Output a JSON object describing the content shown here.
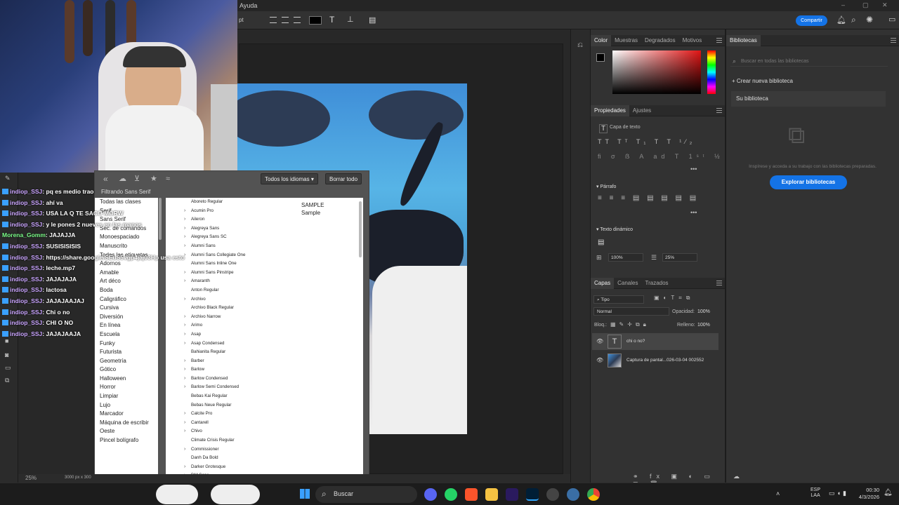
{
  "menu": {
    "help": "Ayuda"
  },
  "options_bar": {
    "font_size_unit": "pt",
    "share_label": "Compartir"
  },
  "color_panel": {
    "tabs": [
      "Color",
      "Muestras",
      "Degradados",
      "Motivos"
    ],
    "foreground": "#000000",
    "hue_selected": "#e01414"
  },
  "properties_panel": {
    "tabs": [
      "Propiedades",
      "Ajustes"
    ],
    "layer_type": "Capa de texto",
    "paragraph_label": "Párrafo",
    "dynamic_text_label": "Texto dinámico",
    "width_value": "100%",
    "tracking_value": "25%"
  },
  "libraries_panel": {
    "tab": "Bibliotecas",
    "search_placeholder": "Buscar en todas las bibliotecas",
    "create_label": "Crear nueva biblioteca",
    "your_library": "Su biblioteca",
    "empty_text": "Inspírese y acceda a su trabajo con las bibliotecas preparadas.",
    "explore_label": "Explorar bibliotecas"
  },
  "layers_panel": {
    "tabs": [
      "Capas",
      "Canales",
      "Trazados"
    ],
    "filter_kind": "Tipo",
    "blend_mode": "Normal",
    "opacity_label": "Opacidad:",
    "opacity_value": "100%",
    "lock_label": "Bloq.:",
    "fill_label": "Relleno:",
    "fill_value": "100%",
    "layers": [
      {
        "name": "chi o no?",
        "kind": "text"
      },
      {
        "name": "Captura de pantal...026-03-04 002552",
        "kind": "image"
      }
    ]
  },
  "font_dialog": {
    "language_select": "Todos los idiomas",
    "clear_label": "Borrar todo",
    "filter_label": "Filtrando Sans Serif",
    "sample_upper": "SAMPLE",
    "sample_lower": "Sample",
    "classes": [
      "Todas las clases",
      "Serif",
      "Sans Serif",
      "Sec. de comandos",
      "Monoespaciado",
      "Manuscrito",
      "Todas las etiquetas",
      "Adornos",
      "Amable",
      "Art déco",
      "Boda",
      "Caligráfico",
      "Cursiva",
      "Diversión",
      "En línea",
      "Escuela",
      "Funky",
      "Futurista",
      "Geometría",
      "Gótico",
      "Halloween",
      "Horror",
      "Limpiar",
      "Lujo",
      "Marcador",
      "Máquina de escribir",
      "Oeste",
      "Pincel bolígrafo"
    ],
    "fonts": [
      {
        "name": "Aboreto Regular",
        "group": false
      },
      {
        "name": "Acumin Pro",
        "group": true
      },
      {
        "name": "Aileron",
        "group": true
      },
      {
        "name": "Alegreya Sans",
        "group": true
      },
      {
        "name": "Alegreya Sans SC",
        "group": true
      },
      {
        "name": "Alumni Sans",
        "group": true
      },
      {
        "name": "Alumni Sans Collegiate One",
        "group": true
      },
      {
        "name": "Alumni Sans Inline One",
        "group": false
      },
      {
        "name": "Alumni Sans Pinstripe",
        "group": true
      },
      {
        "name": "Amaranth",
        "group": true
      },
      {
        "name": "Anton Regular",
        "group": false
      },
      {
        "name": "Archivo",
        "group": true
      },
      {
        "name": "Archivo Black Regular",
        "group": false
      },
      {
        "name": "Archivo Narrow",
        "group": true
      },
      {
        "name": "Arimo",
        "group": true
      },
      {
        "name": "Asap",
        "group": true
      },
      {
        "name": "Asap Condensed",
        "group": true
      },
      {
        "name": "Bahianita Regular",
        "group": false
      },
      {
        "name": "Barber",
        "group": true
      },
      {
        "name": "Barlow",
        "group": true
      },
      {
        "name": "Barlow Condensed",
        "group": true
      },
      {
        "name": "Barlow Semi Condensed",
        "group": true
      },
      {
        "name": "Bebas Kai Regular",
        "group": false
      },
      {
        "name": "Bebas Neue Regular",
        "group": false
      },
      {
        "name": "Calcite Pro",
        "group": true
      },
      {
        "name": "Cantarell",
        "group": true
      },
      {
        "name": "Chivo",
        "group": true
      },
      {
        "name": "Climate Crisis Regular",
        "group": false
      },
      {
        "name": "Commissioner",
        "group": true
      },
      {
        "name": "Danh Da Bold",
        "group": false
      },
      {
        "name": "Darker Grotesque",
        "group": true
      },
      {
        "name": "DM Sans",
        "group": true
      }
    ]
  },
  "chat": [
    {
      "user": "indiop_SSJ",
      "msg": ": pq es medio trao",
      "green": false
    },
    {
      "user": "indiop_SSJ",
      "msg": ": ahí va",
      "green": false
    },
    {
      "user": "indiop_SSJ",
      "msg": ": USA LA Q TE SACO MORW",
      "green": false
    },
    {
      "user": "indiop_SSJ",
      "msg": ": y le pones 2 nueves en las manos",
      "green": false
    },
    {
      "user": "Morena_Gomm",
      "msg": ": JAJAJJA",
      "green": true
    },
    {
      "user": "indiop_SSJ",
      "msg": ": SUSISISISIS",
      "green": false
    },
    {
      "user": "indiop_SSJ",
      "msg": ": https://share.google/SEuS5vgp4jaj03Hp usa esto",
      "green": false
    },
    {
      "user": "indiop_SSJ",
      "msg": ": leche.mp7",
      "green": false
    },
    {
      "user": "indiop_SSJ",
      "msg": ": JAJAJAJA",
      "green": false
    },
    {
      "user": "indiop_SSJ",
      "msg": ": lactosa",
      "green": false
    },
    {
      "user": "indiop_SSJ",
      "msg": ": JAJAJAAJAJ",
      "green": false
    },
    {
      "user": "indiop_SSJ",
      "msg": ": Chi o no",
      "green": false
    },
    {
      "user": "indiop_SSJ",
      "msg": ": CHI O NO",
      "green": false
    },
    {
      "user": "indiop_SSJ",
      "msg": ": JAJAJAAJA",
      "green": false
    }
  ],
  "status": {
    "zoom": "25%",
    "doc_size": "3000 px x 300"
  },
  "taskbar": {
    "search_label": "Buscar",
    "lang": "ESP",
    "lang2": "LAA",
    "time": "00:30",
    "date": "4/3/2026"
  }
}
